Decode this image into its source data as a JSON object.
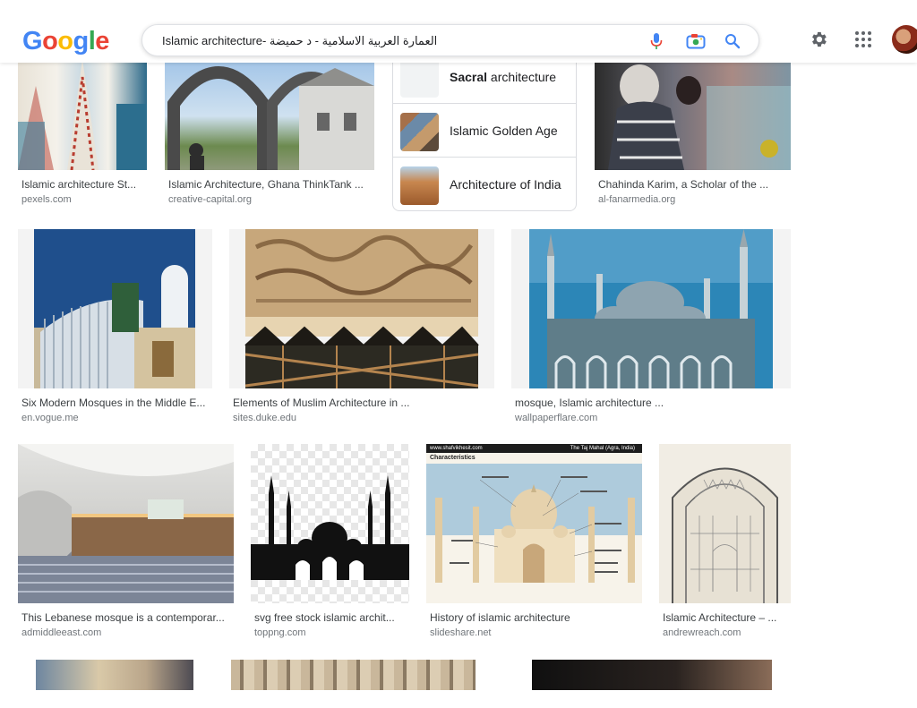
{
  "header": {
    "logo_letters": [
      "G",
      "o",
      "o",
      "g",
      "l",
      "e"
    ],
    "search_query": "Islamic architecture- العمارة العربية الاسلامية - د حميضة",
    "icons": [
      "mic-icon",
      "camera-icon",
      "search-icon",
      "gear-icon",
      "apps-icon",
      "avatar"
    ]
  },
  "colors": {
    "google_blue": "#4285F4",
    "google_red": "#EA4335",
    "google_yellow": "#FBBC05",
    "google_green": "#34A853",
    "caption_text": "#3c4043",
    "source_text": "#70757a"
  },
  "related": {
    "items": [
      {
        "bold": "Sacral",
        "rest": " architecture"
      },
      {
        "bold": "",
        "rest": "Islamic Golden Age"
      },
      {
        "bold": "",
        "rest": "Architecture of India"
      }
    ]
  },
  "results": [
    {
      "caption": "Islamic architecture St...",
      "source": "pexels.com"
    },
    {
      "caption": "Islamic Architecture, Ghana ThinkTank ...",
      "source": "creative-capital.org"
    },
    {
      "caption": "Chahinda Karim, a Scholar of the ...",
      "source": "al-fanarmedia.org"
    },
    {
      "caption": "Six Modern Mosques in the Middle E...",
      "source": "en.vogue.me"
    },
    {
      "caption": "Elements of Muslim Architecture in ...",
      "source": "sites.duke.edu"
    },
    {
      "caption": "mosque, Islamic architecture ...",
      "source": "wallpaperflare.com"
    },
    {
      "caption": "This Lebanese mosque is a contemporar...",
      "source": "admiddleeast.com"
    },
    {
      "caption": "svg free stock islamic archit...",
      "source": "toppng.com"
    },
    {
      "caption": "History of islamic architecture",
      "source": "slideshare.net"
    },
    {
      "caption": "Islamic Architecture – ...",
      "source": "andrewreach.com"
    }
  ],
  "taj_card": {
    "site": "www.shafvikhesit.com",
    "title": "The Taj Mahal (Agra, India)",
    "heading": "Characteristics"
  }
}
